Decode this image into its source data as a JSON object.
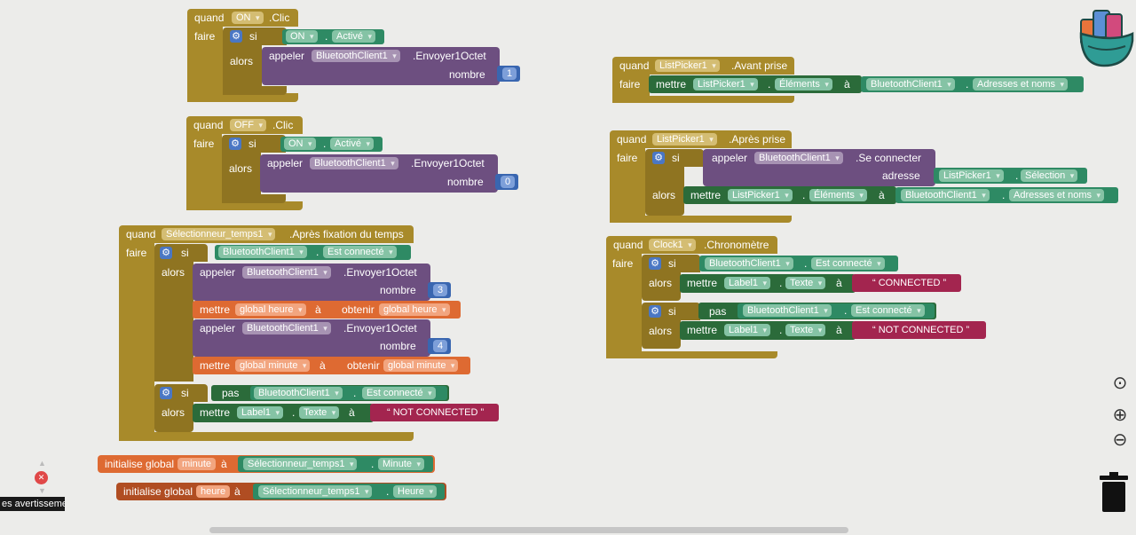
{
  "words": {
    "quand": "quand",
    "faire": "faire",
    "si": "si",
    "alors": "alors",
    "appeler": "appeler",
    "mettre": "mettre",
    "a": "à",
    "obtenir": "obtenir",
    "nombre": "nombre",
    "adresse": "adresse",
    "pas": "pas",
    "initialise": "initialise global",
    "dot": "."
  },
  "on_block": {
    "component": "ON",
    "event": ".Clic",
    "cond_comp": "ON",
    "cond_prop": "Activé",
    "call_comp": "BluetoothClient1",
    "call_method": ".Envoyer1Octet",
    "num": "1"
  },
  "off_block": {
    "component": "OFF",
    "event": ".Clic",
    "cond_comp": "ON",
    "cond_prop": "Activé",
    "call_comp": "BluetoothClient1",
    "call_method": ".Envoyer1Octet",
    "num": "0"
  },
  "timer_block": {
    "component": "Sélectionneur_temps1",
    "event": ".Après fixation du temps",
    "cond_comp": "BluetoothClient1",
    "cond_prop": "Est connecté",
    "call1_comp": "BluetoothClient1",
    "call1_method": ".Envoyer1Octet",
    "num1": "3",
    "set1_var": "global heure",
    "get1_var": "global heure",
    "call2_comp": "BluetoothClient1",
    "call2_method": ".Envoyer1Octet",
    "num2": "4",
    "set2_var": "global minute",
    "get2_var": "global minute",
    "cond2_comp": "BluetoothClient1",
    "cond2_prop": "Est connecté",
    "label_comp": "Label1",
    "label_prop": "Texte",
    "text": "NOT CONNECTED"
  },
  "init_minute": {
    "var": "minute",
    "comp": "Sélectionneur_temps1",
    "prop": "Minute"
  },
  "init_heure": {
    "var": "heure",
    "comp": "Sélectionneur_temps1",
    "prop": "Heure"
  },
  "lp_before": {
    "component": "ListPicker1",
    "event": ".Avant prise",
    "set_comp": "ListPicker1",
    "set_prop": "Éléments",
    "val_comp": "BluetoothClient1",
    "val_prop": "Adresses et noms"
  },
  "lp_after": {
    "component": "ListPicker1",
    "event": ".Après prise",
    "call_comp": "BluetoothClient1",
    "call_method": ".Se connecter",
    "addr_comp": "ListPicker1",
    "addr_prop": "Sélection",
    "set_comp": "ListPicker1",
    "set_prop": "Éléments",
    "val_comp": "BluetoothClient1",
    "val_prop": "Adresses et noms"
  },
  "clock_block": {
    "component": "Clock1",
    "event": ".Chronomètre",
    "cond1_comp": "BluetoothClient1",
    "cond1_prop": "Est connecté",
    "label1_comp": "Label1",
    "label1_prop": "Texte",
    "text1": "CONNECTED",
    "cond2_comp": "BluetoothClient1",
    "cond2_prop": "Est connecté",
    "label2_comp": "Label1",
    "label2_prop": "Texte",
    "text2": "NOT CONNECTED"
  },
  "warnings": {
    "label": "es avertisseme"
  },
  "icons": {
    "gear": "⚙",
    "close": "✕",
    "target": "⊙",
    "plus": "⊕",
    "minus": "⊖",
    "trash": "🗑"
  }
}
